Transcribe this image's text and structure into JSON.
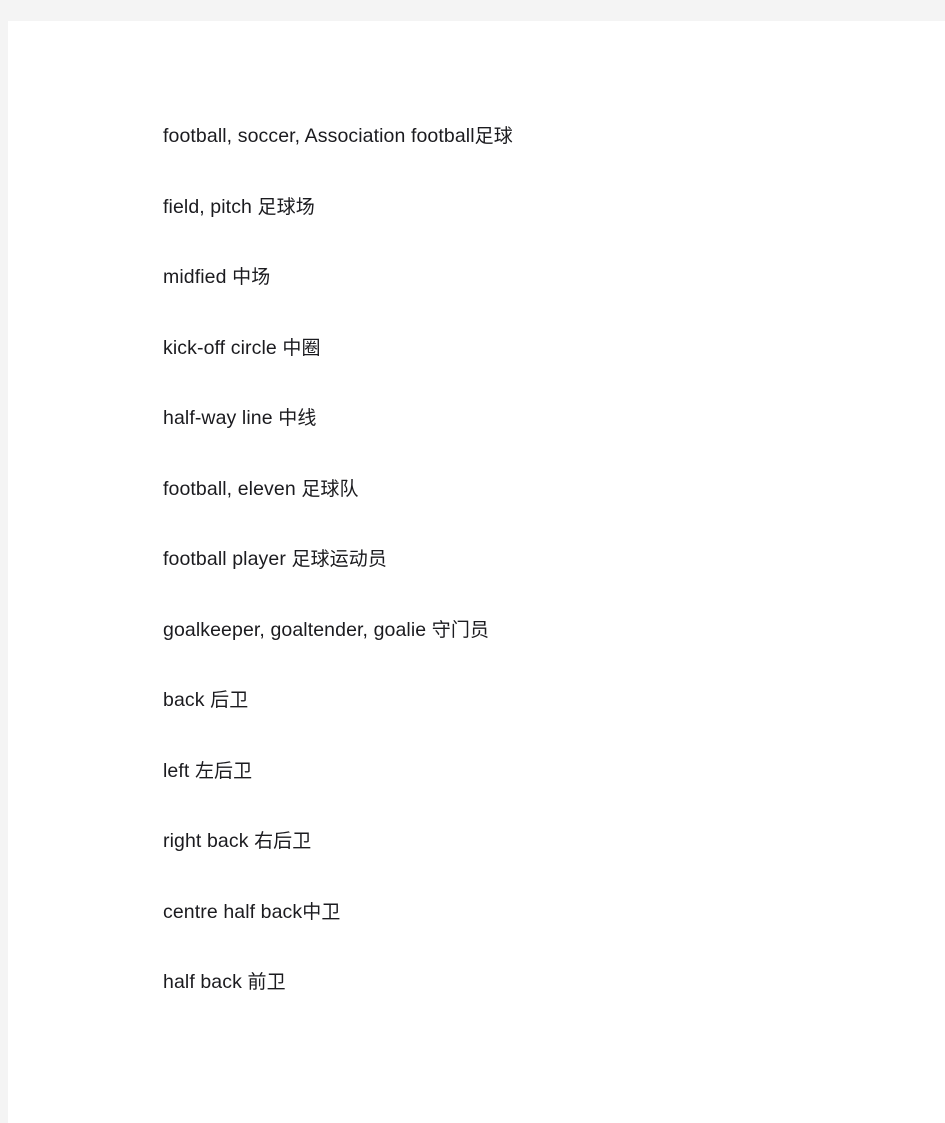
{
  "document": {
    "type": "glossary",
    "topic": "Football (soccer) English-Chinese vocabulary",
    "page_background": "#ffffff",
    "margin_background": "#f4f4f4",
    "text_color": "#1b1b1f",
    "entries": [
      {
        "english": "football, soccer, Association football",
        "separator": "",
        "chinese": "足球"
      },
      {
        "english": "field, pitch",
        "separator": " ",
        "chinese": "足球场"
      },
      {
        "english": "midfied",
        "separator": " ",
        "chinese": "中场"
      },
      {
        "english": "kick-off circle",
        "separator": " ",
        "chinese": "中圈"
      },
      {
        "english": "half-way line",
        "separator": " ",
        "chinese": "中线"
      },
      {
        "english": "football, eleven",
        "separator": " ",
        "chinese": "足球队"
      },
      {
        "english": "football player",
        "separator": " ",
        "chinese": "足球运动员"
      },
      {
        "english": "goalkeeper, goaltender, goalie",
        "separator": " ",
        "chinese": "守门员"
      },
      {
        "english": "back",
        "separator": " ",
        "chinese": "后卫"
      },
      {
        "english": "left",
        "separator": " ",
        "chinese": "左后卫"
      },
      {
        "english": "right back",
        "separator": " ",
        "chinese": "右后卫"
      },
      {
        "english": "centre half back",
        "separator": "",
        "chinese": "中卫"
      },
      {
        "english": "half back",
        "separator": " ",
        "chinese": "前卫"
      }
    ]
  }
}
